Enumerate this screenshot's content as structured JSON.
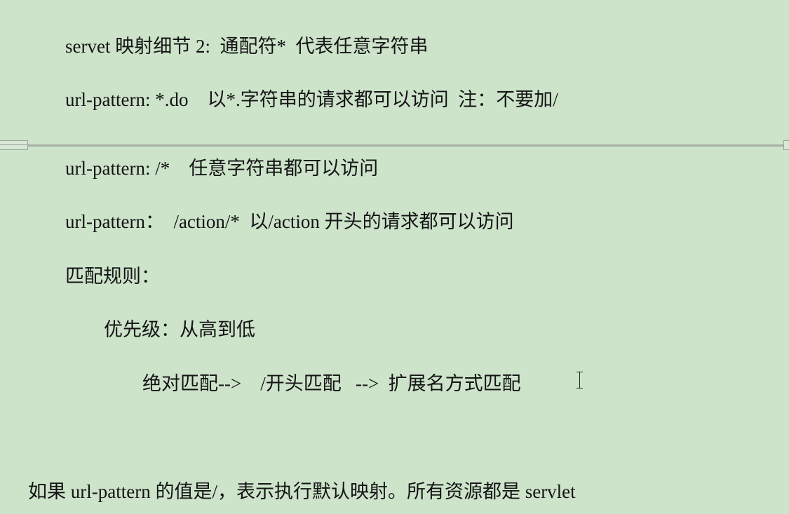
{
  "lines": [
    "servet 映射细节 2:  通配符*  代表任意字符串",
    "url-pattern: *.do    以*.字符串的请求都可以访问  注：不要加/",
    "url-pattern: /*    任意字符串都可以访问",
    "url-pattern：  /action/*  以/action 开头的请求都可以访问",
    "匹配规则：",
    "优先级：从高到低",
    "绝对匹配-->    /开头匹配   -->  扩展名方式匹配",
    "如果 url-pattern 的值是/，表示执行默认映射。所有资源都是 servlet"
  ]
}
